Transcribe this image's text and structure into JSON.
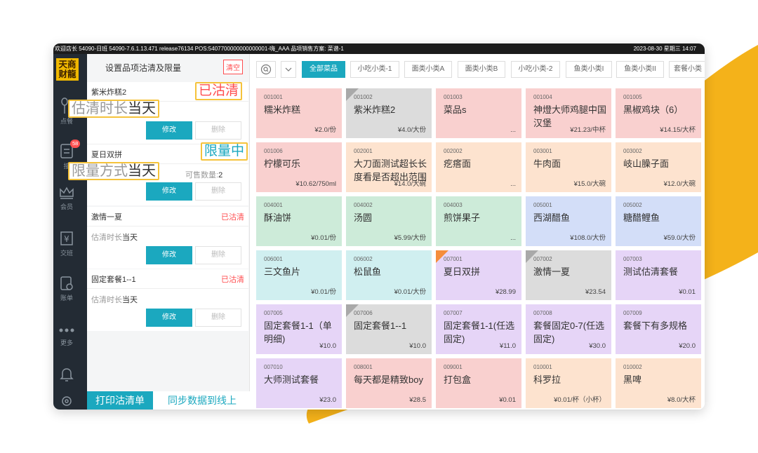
{
  "colors": {
    "accent": "#1ba8bf",
    "danger": "#ff4d4f",
    "highlight": "#f5c33b",
    "deco_yellow": "#f4b21a",
    "sidebar_bg": "#232b34"
  },
  "status_bar": {
    "left": "欢迎店长  54090-日班  54090-7.6.1.13.471  release76134  POS:5407700000000000001-嗨_AAA  品项销售方案: 菜谱-1",
    "right": "2023-08-30  星期三  14:07"
  },
  "sidebar": {
    "logo": [
      "天商",
      "财龍"
    ],
    "items": [
      {
        "label": "点餐",
        "icon": "spoon-fork-icon"
      },
      {
        "label": "接",
        "icon": "order-clipboard-icon",
        "badge": "58"
      },
      {
        "label": "会员",
        "icon": "crown-icon"
      },
      {
        "label": "交班",
        "icon": "yen-register-icon"
      },
      {
        "label": "账单",
        "icon": "bill-icon"
      },
      {
        "label": "更多",
        "icon": "more-dots-icon"
      },
      {
        "label": "",
        "icon": "bell-icon"
      },
      {
        "label": "",
        "icon": "settings-icon"
      }
    ]
  },
  "panel": {
    "title": "设置品项沽清及限量",
    "clear_label": "清空",
    "cards": [
      {
        "name": "紫米炸糕2",
        "tag": "",
        "sub_label": "估清时长",
        "sub_value": "当天",
        "qty_label": "",
        "qty_value": "",
        "edit": "修改",
        "delete": "删除"
      },
      {
        "name": "夏日双拼",
        "tag": "",
        "sub_label": "限量方式",
        "sub_value": "当天",
        "qty_label": "可售数量:",
        "qty_value": "2",
        "edit": "修改",
        "delete": "删除"
      },
      {
        "name": "激情一夏",
        "tag": "已沽清",
        "sub_label": "估清时长",
        "sub_value": "当天",
        "qty_label": "",
        "qty_value": "",
        "edit": "修改",
        "delete": "删除"
      },
      {
        "name": "固定套餐1--1",
        "tag": "已沽清",
        "sub_label": "估清时长",
        "sub_value": "当天",
        "qty_label": "",
        "qty_value": "",
        "edit": "修改",
        "delete": "删除"
      }
    ],
    "print_label": "打印沽清单",
    "sync_label": "同步数据到线上"
  },
  "callouts": {
    "sold_out": "已沽清",
    "duration_light": "估清时长",
    "duration_dark": "当天",
    "limit": "限量中",
    "method_light": "限量方式",
    "method_dark": "当天"
  },
  "tabs": [
    "全部菜品",
    "小吃小类-1",
    "面类小类A",
    "面类小类B",
    "小吃小类-2",
    "鱼类小类I",
    "鱼类小类II",
    "套餐小类"
  ],
  "dishes": [
    {
      "code": "001001",
      "name": "糯米炸糕",
      "price": "¥2.0/份",
      "color": "#f9d0cf",
      "corner": ""
    },
    {
      "code": "001002",
      "name": "紫米炸糕2",
      "price": "¥4.0/大份",
      "color": "#dcdcdc",
      "corner": "#a9a9a9"
    },
    {
      "code": "001003",
      "name": "菜品s",
      "price": "...",
      "color": "#f9d0cf",
      "corner": ""
    },
    {
      "code": "001004",
      "name": "神燈大师鸡腿中国汉堡",
      "price": "¥21.23/中杯",
      "color": "#f9d0cf",
      "corner": ""
    },
    {
      "code": "001005",
      "name": "黑椒鸡块（6）",
      "price": "¥14.15/大杯",
      "color": "#f9d0cf",
      "corner": ""
    },
    {
      "code": "001006",
      "name": "柠檬可乐",
      "price": "¥10.62/750ml",
      "color": "#f9d0cf",
      "corner": ""
    },
    {
      "code": "002001",
      "name": "大刀面测试超长长度看是否超出范围",
      "price": "¥14.0/大碗",
      "color": "#fde3cf",
      "corner": ""
    },
    {
      "code": "002002",
      "name": "疙瘩面",
      "price": "...",
      "color": "#fde3cf",
      "corner": ""
    },
    {
      "code": "003001",
      "name": "牛肉面",
      "price": "¥15.0/大碗",
      "color": "#fde3cf",
      "corner": ""
    },
    {
      "code": "003002",
      "name": "岐山臊子面",
      "price": "¥12.0/大碗",
      "color": "#fde3cf",
      "corner": ""
    },
    {
      "code": "004001",
      "name": "酥油饼",
      "price": "¥0.01/份",
      "color": "#cdebd9",
      "corner": ""
    },
    {
      "code": "004002",
      "name": "汤圆",
      "price": "¥5.99/大份",
      "color": "#cdebd9",
      "corner": ""
    },
    {
      "code": "004003",
      "name": "煎饼果子",
      "price": "...",
      "color": "#cdebd9",
      "corner": ""
    },
    {
      "code": "005001",
      "name": "西湖醋鱼",
      "price": "¥108.0/大份",
      "color": "#d3def8",
      "corner": ""
    },
    {
      "code": "005002",
      "name": "糖醋鲤鱼",
      "price": "¥59.0/大份",
      "color": "#d3def8",
      "corner": ""
    },
    {
      "code": "006001",
      "name": "三文鱼片",
      "price": "¥0.01/份",
      "color": "#d0eff0",
      "corner": ""
    },
    {
      "code": "006002",
      "name": "松鼠鱼",
      "price": "¥0.01/大份",
      "color": "#d0eff0",
      "corner": ""
    },
    {
      "code": "007001",
      "name": "夏日双拼",
      "price": "¥28.99",
      "color": "#e6d5f7",
      "corner": "#f58d3b"
    },
    {
      "code": "007002",
      "name": "激情一夏",
      "price": "¥23.54",
      "color": "#dcdcdc",
      "corner": "#a9a9a9"
    },
    {
      "code": "007003",
      "name": "测试估清套餐",
      "price": "¥0.01",
      "color": "#e6d5f7",
      "corner": ""
    },
    {
      "code": "007005",
      "name": "固定套餐1-1（单明细)",
      "price": "¥10.0",
      "color": "#e6d5f7",
      "corner": ""
    },
    {
      "code": "007006",
      "name": "固定套餐1--1",
      "price": "¥10.0",
      "color": "#dcdcdc",
      "corner": "#a9a9a9"
    },
    {
      "code": "007007",
      "name": "固定套餐1-1(任选固定)",
      "price": "¥11.0",
      "color": "#e6d5f7",
      "corner": ""
    },
    {
      "code": "007008",
      "name": "套餐固定0-7(任选固定)",
      "price": "¥30.0",
      "color": "#e6d5f7",
      "corner": ""
    },
    {
      "code": "007009",
      "name": "套餐下有多规格",
      "price": "¥20.0",
      "color": "#e6d5f7",
      "corner": ""
    },
    {
      "code": "007010",
      "name": "大师测试套餐",
      "price": "¥23.0",
      "color": "#e6d5f7",
      "corner": ""
    },
    {
      "code": "008001",
      "name": "每天都是精致boy",
      "price": "¥28.5",
      "color": "#f9d0cf",
      "corner": ""
    },
    {
      "code": "009001",
      "name": "打包盒",
      "price": "¥0.01",
      "color": "#f9d0cf",
      "corner": ""
    },
    {
      "code": "010001",
      "name": "科罗拉",
      "price": "¥0.01/杯（小杯）",
      "color": "#fde3cf",
      "corner": ""
    },
    {
      "code": "010002",
      "name": "黑啤",
      "price": "¥8.0/大杯",
      "color": "#fde3cf",
      "corner": ""
    }
  ]
}
